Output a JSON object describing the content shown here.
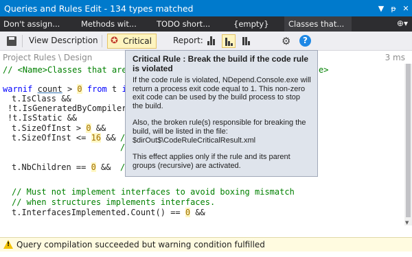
{
  "window": {
    "title": "Queries and Rules Edit  - 134 types matched",
    "controls": {
      "dropdown": "▼",
      "pin": "ᵽ",
      "close": "✕"
    }
  },
  "tabs": [
    {
      "label": "Don't assign..."
    },
    {
      "label": "Methods wit..."
    },
    {
      "label": "TODO short..."
    },
    {
      "label": "{empty}"
    },
    {
      "label": "Classes that...",
      "active": true
    }
  ],
  "tab_tools": "⊕▾",
  "toolbar": {
    "view_description": "View Description",
    "critical_label": "Critical",
    "report_label": "Report:"
  },
  "breadcrumb": "Project Rules \\ Design",
  "elapsed": "3 ms",
  "code": {
    "line1_start": "// <Name>Classes that are c",
    "line1_end": "e>",
    "warnif": "warnif",
    "count": "count",
    "gt": " > ",
    "zero": "0",
    "from": "from",
    "t": " t ",
    "in": "in",
    "l_isclass": "t.IsClass &&",
    "l_isgenerated": "!t.IsGeneratedByCompiler &",
    "l_isstatic": "!t.IsStatic &&",
    "l_sizeofinst1_a": "t.SizeOfInst > ",
    "l_sizeofinst1_b": "0",
    "l_sizeofinst1_c": " &&",
    "l_sizeofinst2_a": "t.SizeOfInst <= ",
    "l_sizeofinst2_b": "16",
    "l_sizeofinst2_c": " &&",
    "l_sizeofinst2_cm": "/",
    "l_blank_cm": "/",
    "l_nbchildren_a": "t.NbChildren == ",
    "l_nbchildren_b": "0",
    "l_nbchildren_c": " &&",
    "l_nbchildren_cm": "/",
    "l_comment1": "// Must not implement interfaces to avoid boxing mismatch",
    "l_comment2": "// when structures implements interfaces.",
    "l_ifaces_a": "t.InterfacesImplemented.Count() == ",
    "l_ifaces_b": "0",
    "l_ifaces_c": " &&"
  },
  "tooltip": {
    "title": "Critical Rule : Break the build if the code rule is violated",
    "p1": "If the code rule is violated, NDepend.Console.exe will return a process exit code equal to 1. This non-zero exit code can be used by the build process to stop the build.",
    "p2": "Also, the broken rule(s) responsible for breaking the build, will be listed in the file:",
    "p2_path": "$dirOut$\\CodeRuleCriticalResult.xml",
    "p3": "This effect applies only if the rule and its parent groups (recursive) are activated."
  },
  "status": {
    "message": "Query compilation succeeded but warning condition fulfilled"
  },
  "colors": {
    "title_bar": "#007acc",
    "tab_strip": "#2d2d30",
    "keyword": "#0000ff",
    "comment": "#008000",
    "number": "#a07000",
    "tooltip_bg": "#dfe4ec",
    "status_bg": "#fffbe0",
    "warning": "#f2c200"
  }
}
